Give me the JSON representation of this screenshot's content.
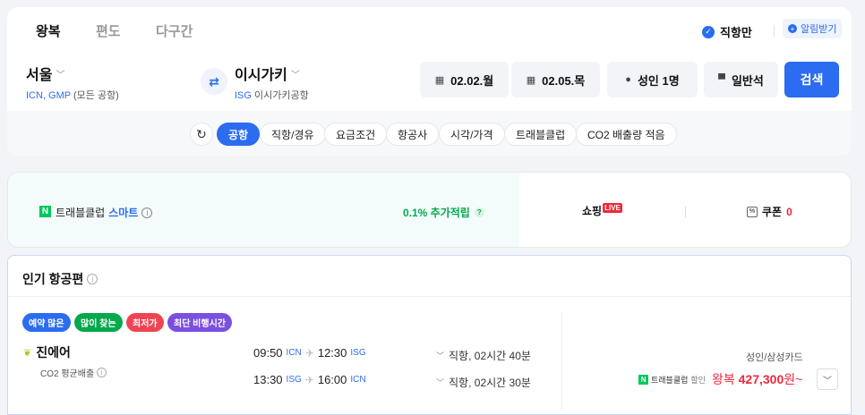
{
  "tabs": [
    {
      "label": "왕복",
      "active": true
    },
    {
      "label": "편도",
      "active": false
    },
    {
      "label": "다구간",
      "active": false
    }
  ],
  "direct_only": {
    "label": "직항만",
    "checked": true
  },
  "alert_button": {
    "label": "알림받기"
  },
  "origin": {
    "city": "서울",
    "codes": "ICN, GMP",
    "desc": "(모든 공항)"
  },
  "destination": {
    "city": "이시가키",
    "code": "ISG",
    "desc": "이시가키공항"
  },
  "depart_date": "02.02.월",
  "return_date": "02.05.목",
  "passengers": "성인 1명",
  "seat_class": "일반석",
  "search_label": "검색",
  "filters": [
    {
      "label": "공항",
      "active": true
    },
    {
      "label": "직항/경유",
      "active": false
    },
    {
      "label": "요금조건",
      "active": false
    },
    {
      "label": "항공사",
      "active": false
    },
    {
      "label": "시각/가격",
      "active": false
    },
    {
      "label": "트래블클럽",
      "active": false
    },
    {
      "label": "CO2 배출량 적음",
      "active": false
    }
  ],
  "promo": {
    "n_badge": "N",
    "travel_club": "트래블클럽",
    "smart": "스마트",
    "points": "0.1% 추가적립",
    "shopping": "쇼핑",
    "live": "LIVE",
    "coupon": "쿠폰",
    "coupon_count": "0"
  },
  "popular": {
    "title": "인기 항공편",
    "tags": [
      {
        "label": "예약 많은",
        "color": "#2b6cf0"
      },
      {
        "label": "많이 찾는",
        "color": "#03a94c"
      },
      {
        "label": "최저가",
        "color": "#f04452"
      },
      {
        "label": "최단 비행시간",
        "color": "#7b4fe0"
      }
    ],
    "airline": "진에어",
    "co2": "CO2 평균배출",
    "legs": [
      {
        "dep_time": "09:50",
        "dep_code": "ICN",
        "arr_time": "12:30",
        "arr_code": "ISG",
        "duration": "직항, 02시간 40분"
      },
      {
        "dep_time": "13:30",
        "dep_code": "ISG",
        "arr_time": "16:00",
        "arr_code": "ICN",
        "duration": "직항, 02시간 30분"
      }
    ],
    "card_label": "성인/삼성카드",
    "discount_club": "트래블클럽",
    "discount_label": "할인",
    "price_prefix": "왕복",
    "price": "427,300",
    "price_suffix": "원~"
  }
}
